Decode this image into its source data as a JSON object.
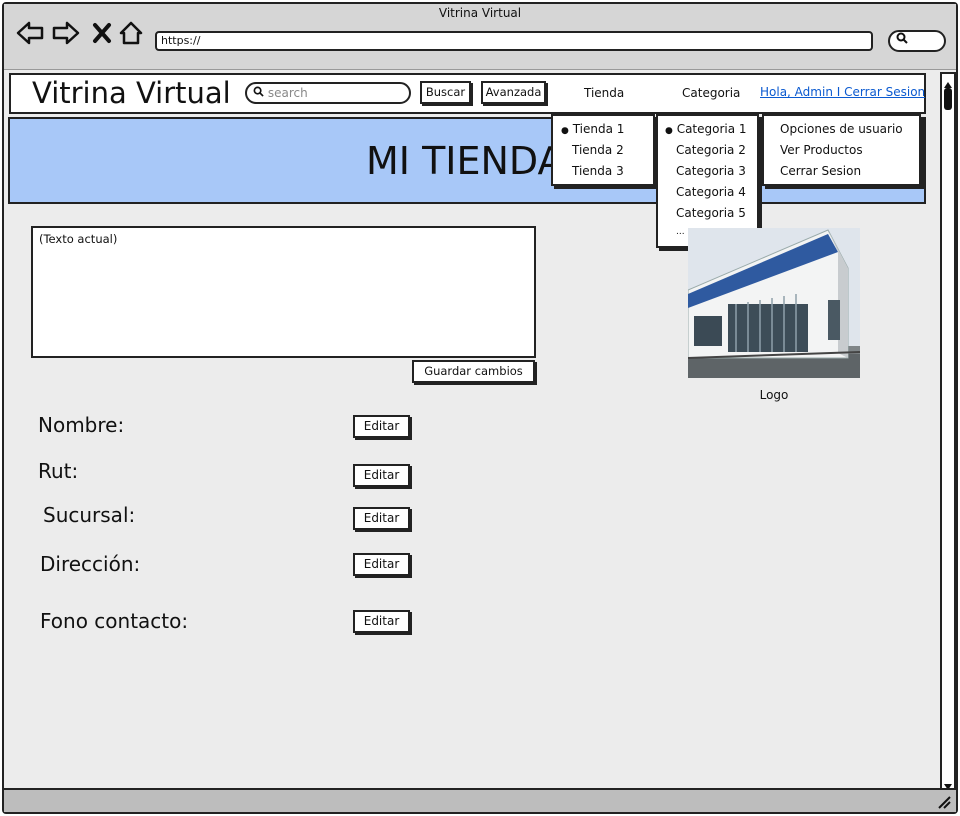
{
  "browser": {
    "window_title": "Vitrina Virtual",
    "url": "https://",
    "icons": [
      "back-arrow-icon",
      "forward-arrow-icon",
      "stop-icon",
      "home-icon",
      "search-icon"
    ]
  },
  "header": {
    "site_title": "Vitrina Virtual",
    "search_placeholder": "search",
    "search_button": "Buscar",
    "advanced_button": "Avanzada",
    "menu_tienda": "Tienda",
    "menu_categoria": "Categoria",
    "user_link": "Hola, Admin I Cerrar Sesion"
  },
  "banner": {
    "title": "MI TIENDA"
  },
  "dropdowns": {
    "tienda": [
      "Tienda 1",
      "Tienda 2",
      "Tienda 3"
    ],
    "categoria": [
      "Categoria 1",
      "Categoria 2",
      "Categoria 3",
      "Categoria 4",
      "Categoria 5",
      "..."
    ],
    "usuario": [
      "Opciones de usuario",
      "Ver Productos",
      "Cerrar Sesion"
    ]
  },
  "editor": {
    "current_text": "(Texto actual)",
    "save_button": "Guardar cambios"
  },
  "logo": {
    "label": "Logo"
  },
  "fields": [
    {
      "label": "Nombre:",
      "button": "Editar"
    },
    {
      "label": "Rut:",
      "button": "Editar"
    },
    {
      "label": "Sucursal:",
      "button": "Editar"
    },
    {
      "label": "Dirección:",
      "button": "Editar"
    },
    {
      "label": "Fono contacto:",
      "button": "Editar"
    }
  ]
}
